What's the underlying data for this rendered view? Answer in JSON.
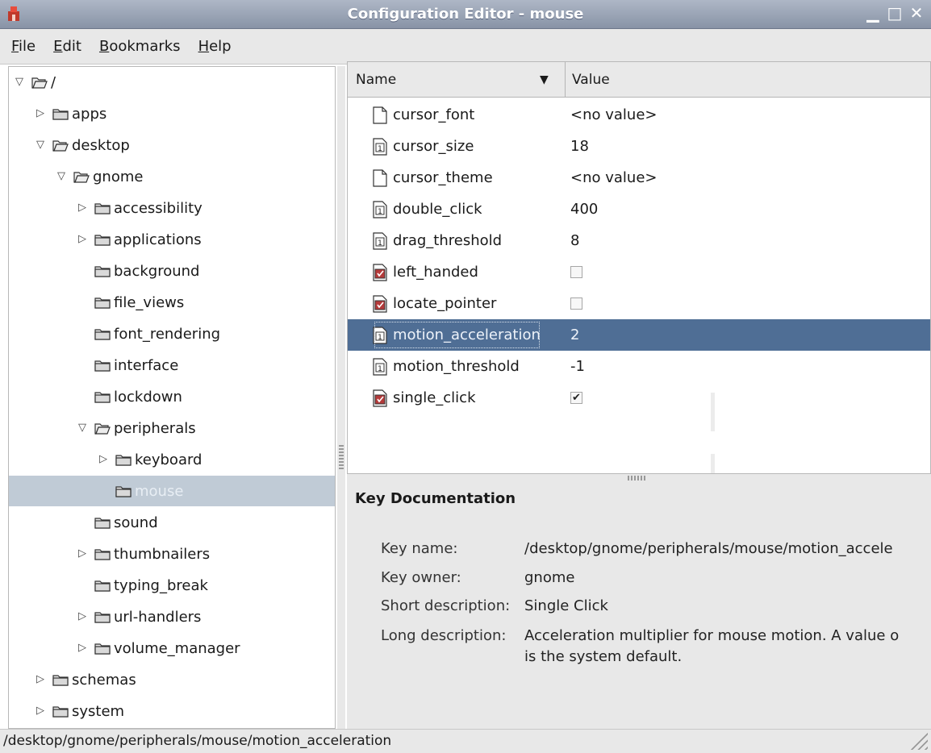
{
  "window": {
    "title": "Configuration Editor - mouse",
    "buttons": [
      "minimize",
      "maximize",
      "close"
    ]
  },
  "menu": [
    {
      "label": "File",
      "mnemonic": "F",
      "rest": "ile"
    },
    {
      "label": "Edit",
      "mnemonic": "E",
      "rest": "dit"
    },
    {
      "label": "Bookmarks",
      "mnemonic": "B",
      "rest": "ookmarks"
    },
    {
      "label": "Help",
      "mnemonic": "H",
      "rest": "elp"
    }
  ],
  "tree": [
    {
      "label": "/",
      "expander": "open",
      "folder": "open",
      "depth": 0
    },
    {
      "label": "apps",
      "expander": "closed",
      "folder": "closed",
      "depth": 1
    },
    {
      "label": "desktop",
      "expander": "open",
      "folder": "open",
      "depth": 1
    },
    {
      "label": "gnome",
      "expander": "open",
      "folder": "open",
      "depth": 2
    },
    {
      "label": "accessibility",
      "expander": "closed",
      "folder": "closed",
      "depth": 3
    },
    {
      "label": "applications",
      "expander": "closed",
      "folder": "closed",
      "depth": 3
    },
    {
      "label": "background",
      "expander": "none",
      "folder": "closed",
      "depth": 3
    },
    {
      "label": "file_views",
      "expander": "none",
      "folder": "closed",
      "depth": 3
    },
    {
      "label": "font_rendering",
      "expander": "none",
      "folder": "closed",
      "depth": 3
    },
    {
      "label": "interface",
      "expander": "none",
      "folder": "closed",
      "depth": 3
    },
    {
      "label": "lockdown",
      "expander": "none",
      "folder": "closed",
      "depth": 3
    },
    {
      "label": "peripherals",
      "expander": "open",
      "folder": "open",
      "depth": 3
    },
    {
      "label": "keyboard",
      "expander": "closed",
      "folder": "closed",
      "depth": 4
    },
    {
      "label": "mouse",
      "expander": "none",
      "folder": "closed",
      "depth": 4,
      "selected": true
    },
    {
      "label": "sound",
      "expander": "none",
      "folder": "closed",
      "depth": 3
    },
    {
      "label": "thumbnailers",
      "expander": "closed",
      "folder": "closed",
      "depth": 3
    },
    {
      "label": "typing_break",
      "expander": "none",
      "folder": "closed",
      "depth": 3
    },
    {
      "label": "url-handlers",
      "expander": "closed",
      "folder": "closed",
      "depth": 3
    },
    {
      "label": "volume_manager",
      "expander": "closed",
      "folder": "closed",
      "depth": 3
    },
    {
      "label": "schemas",
      "expander": "closed",
      "folder": "closed",
      "depth": 1
    },
    {
      "label": "system",
      "expander": "closed",
      "folder": "closed",
      "depth": 1
    }
  ],
  "keys": {
    "columns": {
      "name": "Name",
      "value": "Value"
    },
    "rows": [
      {
        "name": "cursor_font",
        "type": "string",
        "value": "<no value>"
      },
      {
        "name": "cursor_size",
        "type": "int",
        "value": "18"
      },
      {
        "name": "cursor_theme",
        "type": "string",
        "value": "<no value>"
      },
      {
        "name": "double_click",
        "type": "int",
        "value": "400"
      },
      {
        "name": "drag_threshold",
        "type": "int",
        "value": "8"
      },
      {
        "name": "left_handed",
        "type": "bool",
        "checked": false
      },
      {
        "name": "locate_pointer",
        "type": "bool",
        "checked": false
      },
      {
        "name": "motion_acceleration",
        "type": "int",
        "value": "2",
        "selected": true
      },
      {
        "name": "motion_threshold",
        "type": "int",
        "value": "-1"
      },
      {
        "name": "single_click",
        "type": "bool",
        "checked": true
      }
    ]
  },
  "doc": {
    "title": "Key Documentation",
    "key_name_label": "Key name:",
    "key_name": "/desktop/gnome/peripherals/mouse/motion_accele",
    "key_owner_label": "Key owner:",
    "key_owner": "gnome",
    "short_desc_label": "Short description:",
    "short_desc": "Single Click",
    "long_desc_label": "Long description:",
    "long_desc_line1": "Acceleration multiplier for mouse motion. A value o",
    "long_desc_line2": "is the system default."
  },
  "status": "/desktop/gnome/peripherals/mouse/motion_acceleration"
}
